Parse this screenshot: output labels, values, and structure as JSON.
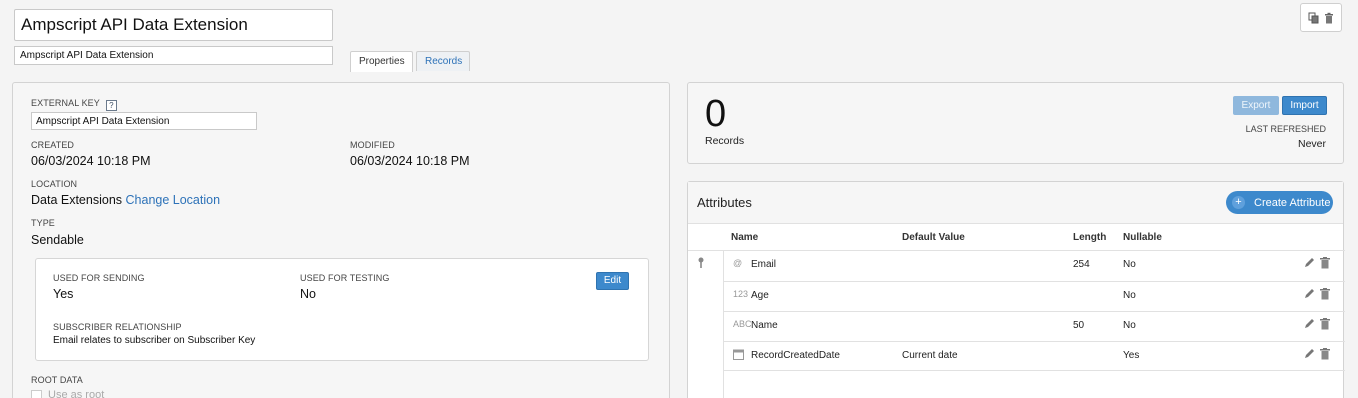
{
  "header": {
    "title_value": "Ampscript API Data Extension",
    "description_value": "Ampscript API Data Extension"
  },
  "tabs": [
    {
      "label": "Properties",
      "active": true
    },
    {
      "label": "Records",
      "active": false
    }
  ],
  "top_actions": {
    "icons": [
      "copy-icon",
      "trash-icon"
    ]
  },
  "properties": {
    "external_key_label": "EXTERNAL KEY",
    "help_glyph": "?",
    "external_key_value": "Ampscript API Data Extension",
    "created_label": "CREATED",
    "created_value": "06/03/2024 10:18 PM",
    "modified_label": "MODIFIED",
    "modified_value": "06/03/2024 10:18 PM",
    "location_label": "LOCATION",
    "location_value": "Data Extensions",
    "change_location_link": "Change Location",
    "type_label": "TYPE",
    "type_value": "Sendable",
    "sending": {
      "used_for_sending_label": "USED FOR SENDING",
      "used_for_sending_value": "Yes",
      "used_for_testing_label": "USED FOR TESTING",
      "used_for_testing_value": "No",
      "edit_label": "Edit",
      "subscriber_relationship_label": "SUBSCRIBER RELATIONSHIP",
      "subscriber_relationship_value": "Email relates to subscriber on Subscriber Key"
    },
    "root_data_label": "ROOT DATA",
    "use_as_root_label": "Use as root"
  },
  "records": {
    "count": "0",
    "count_label": "Records",
    "export_label": "Export",
    "import_label": "Import",
    "last_refreshed_label": "LAST REFRESHED",
    "last_refreshed_value": "Never"
  },
  "attributes": {
    "title": "Attributes",
    "create_label": "Create Attribute",
    "columns": [
      "Name",
      "Default Value",
      "Length",
      "Nullable"
    ],
    "rows": [
      {
        "icon": "@",
        "name": "Email",
        "default": "",
        "length": "254",
        "nullable": "No",
        "primary_key": true
      },
      {
        "icon": "123",
        "name": "Age",
        "default": "",
        "length": "",
        "nullable": "No",
        "primary_key": false
      },
      {
        "icon": "ABC",
        "name": "Name",
        "default": "",
        "length": "50",
        "nullable": "No",
        "primary_key": false
      },
      {
        "icon": "calendar-icon",
        "name": "RecordCreatedDate",
        "default": "Current date",
        "length": "",
        "nullable": "Yes",
        "primary_key": false
      }
    ]
  },
  "colors": {
    "accent": "#3d89cc",
    "link": "#2d72b8",
    "export_disabled": "#8fb8dd"
  }
}
